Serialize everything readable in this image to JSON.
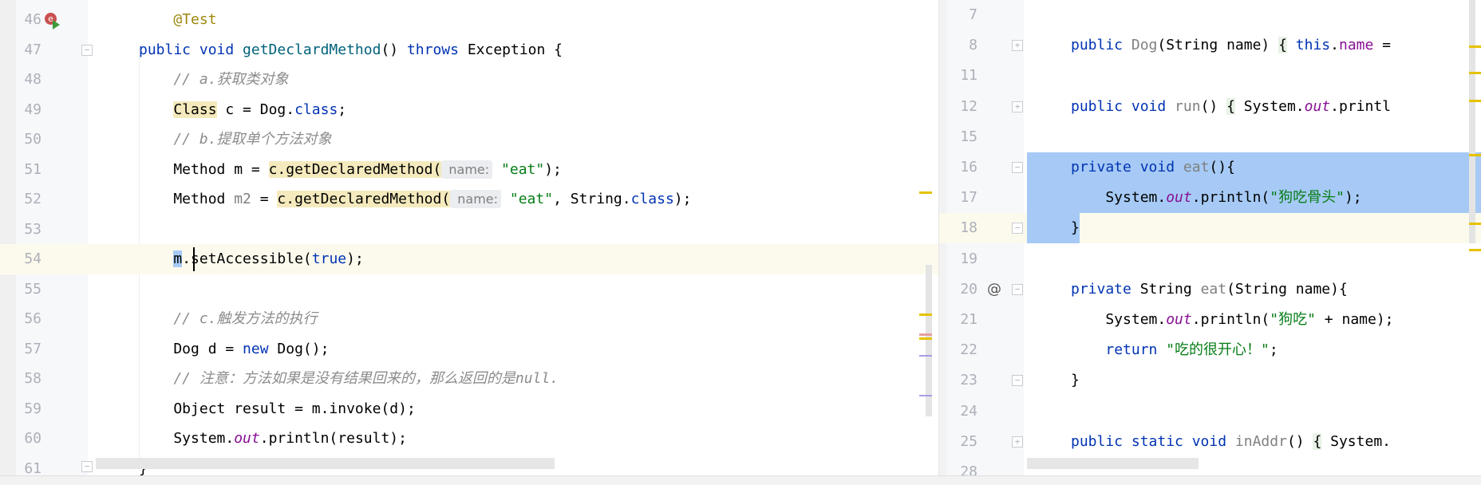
{
  "left_editor": {
    "lines": [
      {
        "n": "46",
        "t": [
          [
            "    ",
            ""
          ],
          [
            "@Test",
            "ann"
          ]
        ]
      },
      {
        "n": "47",
        "t": [
          [
            "public void ",
            "kw"
          ],
          [
            "getDeclardMethod",
            "fn"
          ],
          [
            "() ",
            ""
          ],
          [
            "throws ",
            "kw"
          ],
          [
            "Exception {",
            ""
          ]
        ]
      },
      {
        "n": "48",
        "t": [
          [
            "    // a.获取类对象",
            "cm"
          ]
        ]
      },
      {
        "n": "49",
        "t": [
          [
            "    ",
            ""
          ],
          [
            "Class",
            "hl"
          ],
          [
            " c = Dog.",
            ""
          ],
          [
            "class",
            "kw"
          ],
          [
            ";",
            ""
          ]
        ]
      },
      {
        "n": "50",
        "t": [
          [
            "    // b.提取单个方法对象",
            "cm"
          ]
        ]
      },
      {
        "n": "51",
        "t": [
          [
            "    Method m = ",
            ""
          ],
          [
            "c.getDeclaredMethod(",
            "hl"
          ],
          [
            " name:",
            "hint"
          ],
          [
            " ",
            ""
          ],
          [
            "\"eat\"",
            "str"
          ],
          [
            ");",
            ""
          ]
        ]
      },
      {
        "n": "52",
        "t": [
          [
            "    Method ",
            ""
          ],
          [
            "m2",
            "gray"
          ],
          [
            " = ",
            ""
          ],
          [
            "c.getDeclaredMethod(",
            "hl"
          ],
          [
            " name:",
            "hint"
          ],
          [
            " ",
            ""
          ],
          [
            "\"eat\"",
            "str"
          ],
          [
            ", String.",
            ""
          ],
          [
            "class",
            "kw"
          ],
          [
            ");",
            ""
          ]
        ]
      },
      {
        "n": "53",
        "t": []
      },
      {
        "n": "54",
        "cur": true,
        "t": [
          [
            "    ",
            ""
          ],
          [
            "m",
            "sel"
          ],
          [
            ".setAccessible(",
            ""
          ],
          [
            "true",
            "kw"
          ],
          [
            ");",
            ""
          ]
        ]
      },
      {
        "n": "55",
        "t": []
      },
      {
        "n": "56",
        "t": [
          [
            "    // c.触发方法的执行",
            "cm"
          ]
        ]
      },
      {
        "n": "57",
        "t": [
          [
            "    Dog d = ",
            ""
          ],
          [
            "new ",
            "kw"
          ],
          [
            "Dog();",
            ""
          ]
        ]
      },
      {
        "n": "58",
        "t": [
          [
            "    // 注意：方法如果是没有结果回来的，那么返回的是null.",
            "cm"
          ]
        ]
      },
      {
        "n": "59",
        "t": [
          [
            "    Object result = m.invoke(d);",
            ""
          ]
        ]
      },
      {
        "n": "60",
        "t": [
          [
            "    System.",
            ""
          ],
          [
            "out",
            "sf"
          ],
          [
            ".println(result);",
            ""
          ]
        ]
      },
      {
        "n": "61",
        "t": [
          [
            "}",
            ""
          ]
        ]
      }
    ]
  },
  "right_editor": {
    "lines": [
      {
        "n": "7",
        "t": []
      },
      {
        "n": "8",
        "fold": "+",
        "t": [
          [
            "public ",
            "kw"
          ],
          [
            "Dog",
            "gray"
          ],
          [
            "(String name) ",
            ""
          ],
          [
            "{",
            "fold"
          ],
          [
            " ",
            ""
          ],
          [
            "this",
            "kw"
          ],
          [
            ".",
            ""
          ],
          [
            "name",
            "fld"
          ],
          [
            " = ",
            ""
          ]
        ]
      },
      {
        "n": "11",
        "t": []
      },
      {
        "n": "12",
        "fold": "+",
        "t": [
          [
            "public void ",
            "kw"
          ],
          [
            "run",
            "gray"
          ],
          [
            "() ",
            ""
          ],
          [
            "{",
            "fold"
          ],
          [
            " System.",
            ""
          ],
          [
            "out",
            "sf"
          ],
          [
            ".printl",
            ""
          ]
        ]
      },
      {
        "n": "15",
        "t": []
      },
      {
        "n": "16",
        "fold": "-",
        "selfull": true,
        "t": [
          [
            "private void ",
            "kw"
          ],
          [
            "eat",
            "gray"
          ],
          [
            "(){",
            ""
          ]
        ]
      },
      {
        "n": "17",
        "selfull": true,
        "t": [
          [
            "    System.",
            ""
          ],
          [
            "out",
            "sf"
          ],
          [
            ".println(",
            ""
          ],
          [
            "\"狗吃骨头\"",
            "str"
          ],
          [
            ");",
            ""
          ]
        ]
      },
      {
        "n": "18",
        "fold": "-",
        "cur": true,
        "selpart": true,
        "t": [
          [
            "}",
            ""
          ]
        ]
      },
      {
        "n": "19",
        "t": []
      },
      {
        "n": "20",
        "fold": "-",
        "at": "@",
        "t": [
          [
            "private ",
            "kw"
          ],
          [
            "String ",
            ""
          ],
          [
            "eat",
            "gray"
          ],
          [
            "(String name){",
            ""
          ]
        ]
      },
      {
        "n": "21",
        "t": [
          [
            "    System.",
            ""
          ],
          [
            "out",
            "sf"
          ],
          [
            ".println(",
            ""
          ],
          [
            "\"狗吃\"",
            "str"
          ],
          [
            " + name);",
            ""
          ]
        ]
      },
      {
        "n": "22",
        "t": [
          [
            "    ",
            ""
          ],
          [
            "return ",
            "kw"
          ],
          [
            "\"吃的很开心！\"",
            "str"
          ],
          [
            ";",
            ""
          ]
        ]
      },
      {
        "n": "23",
        "fold": "-",
        "t": [
          [
            "}",
            ""
          ]
        ]
      },
      {
        "n": "24",
        "t": []
      },
      {
        "n": "25",
        "fold": "+",
        "t": [
          [
            "public static void ",
            "kw"
          ],
          [
            "inAddr",
            "gray"
          ],
          [
            "() ",
            ""
          ],
          [
            "{",
            "fold"
          ],
          [
            " System.",
            ""
          ]
        ]
      },
      {
        "n": "28",
        "t": []
      }
    ]
  },
  "icons": {
    "run_gutter": "run-test-icon",
    "override": "override-icon"
  },
  "colors": {
    "keyword": "#0033b3",
    "string": "#067d17",
    "comment": "#8c8c8c",
    "selection": "#a6caf5",
    "highlight": "#f5eabd"
  }
}
